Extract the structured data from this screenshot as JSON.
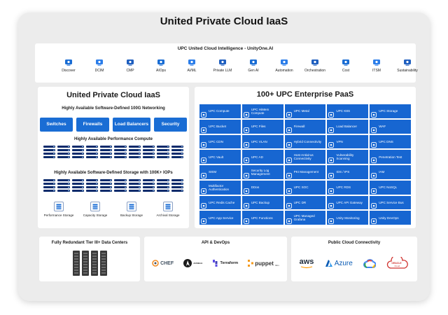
{
  "main_title": "United Private Cloud IaaS",
  "intelligence": {
    "title": "UPC United Cloud Intelligence - UnityOne.AI",
    "items": [
      {
        "label": "Discover",
        "icon": "binoculars-icon"
      },
      {
        "label": "DCIM",
        "icon": "monitor-icon"
      },
      {
        "label": "CMP",
        "icon": "cloud-users-icon"
      },
      {
        "label": "AIOps",
        "icon": "ai-gear-icon"
      },
      {
        "label": "AI/ML",
        "icon": "brain-icon"
      },
      {
        "label": "Private LLM",
        "icon": "llm-icon"
      },
      {
        "label": "Gen AI",
        "icon": "gen-ai-icon"
      },
      {
        "label": "Automation",
        "icon": "automation-gear-icon"
      },
      {
        "label": "Orchestration",
        "icon": "orchestration-icon"
      },
      {
        "label": "Cost",
        "icon": "cost-icon"
      },
      {
        "label": "ITSM",
        "icon": "itsm-icon"
      },
      {
        "label": "Sustainability",
        "icon": "sustainability-icon"
      }
    ]
  },
  "iaas": {
    "title": "United Private Cloud IaaS",
    "networking_title": "Highly Available Software-Defined 100G Networking",
    "networking": [
      "Switches",
      "Firewalls",
      "Load Balancers",
      "Security"
    ],
    "compute_title": "Highly Available Performance Compute",
    "storage_title": "Highly Available Software-Defined Storage with 100K+ IOPs",
    "storage_types": [
      {
        "label": "Performance Storage",
        "icon": "performance-storage-icon"
      },
      {
        "label": "Capacity Storage",
        "icon": "capacity-storage-icon"
      },
      {
        "label": "Backup Storage",
        "icon": "backup-storage-icon"
      },
      {
        "label": "Archival Storage",
        "icon": "archival-storage-icon"
      }
    ]
  },
  "paas": {
    "title": "100+ UPC Enterprise PaaS",
    "tiles": [
      "UPC Compute",
      "UPC HiMem Compute",
      "UPC Metal",
      "UPC K8S",
      "UPC Storage",
      "UPC Bucket",
      "UPC Files",
      "Firewall",
      "Load Balancer",
      "WAF",
      "UPC CDN",
      "UPC VLAN",
      "Hybrid Connectivity",
      "VPN",
      "UPC DNS",
      "UPC Vault",
      "UPC AD",
      "Host Antivirus Connectivity",
      "Vulnerability Scanning",
      "Penetration Test",
      "SIEM",
      "Security Log Management",
      "PKI Management",
      "IDS / IPS",
      "IAM",
      "Multifactor Authentication",
      "DDos",
      "UPC SOC",
      "UPC RDS",
      "UPC NoSQL",
      "UPC Redis Cache",
      "UPC Backup",
      "UPC DR",
      "UPC API Gateway",
      "UPC Service Bus",
      "UPC App Service",
      "UPC Functions",
      "UPC Managed Grafana",
      "Unity Monitoring",
      "Unity DevOps"
    ]
  },
  "datacenters": {
    "title": "Fully Redundant Tier III+ Data Centers"
  },
  "devops": {
    "title": "API & DevOps",
    "tools": [
      "CHEF",
      "ANSIBLE",
      "Terraform",
      "puppet"
    ],
    "puppet_sub": "labs"
  },
  "public_cloud": {
    "title": "Public Cloud Connectivity",
    "providers": [
      "aws",
      "Azure",
      "ORACLE"
    ],
    "oracle_sub": "Cloud"
  },
  "colors": {
    "tile_blue": "#1766d1",
    "server_navy": "#0b2a6b",
    "panel_bg": "#ffffff",
    "frame_bg": "#ececec"
  }
}
